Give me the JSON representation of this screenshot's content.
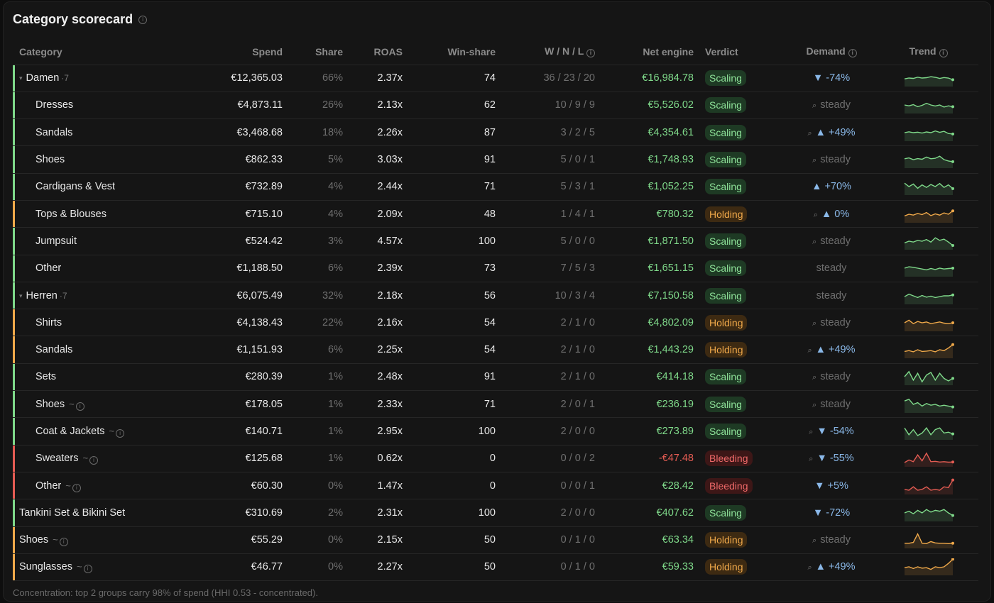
{
  "title": "Category scorecard",
  "columns": {
    "category": "Category",
    "spend": "Spend",
    "share": "Share",
    "roas": "ROAS",
    "winshare": "Win-share",
    "wnl": "W / N / L",
    "net": "Net engine",
    "verdict": "Verdict",
    "demand": "Demand",
    "trend": "Trend"
  },
  "colors": {
    "scaling": "#7fd98a",
    "holding": "#f0a94a",
    "bleeding": "#e45c53"
  },
  "rows": [
    {
      "name": "Damen",
      "level": "group",
      "count": "7",
      "spend": "€12,365.03",
      "share": "66%",
      "roas": "2.37x",
      "winshare": "74",
      "wnl": "36 / 23 / 20",
      "net": "€16,984.78",
      "net_sign": "pos",
      "verdict": "Scaling",
      "tone": "green",
      "demand": "▼ -74%",
      "demand_mag": false,
      "demand_style": "blue",
      "trend": [
        0.55,
        0.5,
        0.52,
        0.45,
        0.5,
        0.48,
        0.42,
        0.46,
        0.52,
        0.47,
        0.5,
        0.6
      ]
    },
    {
      "name": "Dresses",
      "level": "child",
      "spend": "€4,873.11",
      "share": "26%",
      "roas": "2.13x",
      "winshare": "62",
      "wnl": "10 / 9 / 9",
      "net": "€5,526.02",
      "net_sign": "pos",
      "verdict": "Scaling",
      "tone": "green",
      "demand": "steady",
      "demand_mag": true,
      "demand_style": "steady",
      "trend": [
        0.5,
        0.55,
        0.48,
        0.6,
        0.52,
        0.4,
        0.5,
        0.56,
        0.5,
        0.62,
        0.55,
        0.6
      ]
    },
    {
      "name": "Sandals",
      "level": "child",
      "spend": "€3,468.68",
      "share": "18%",
      "roas": "2.26x",
      "winshare": "87",
      "wnl": "3 / 2 / 5",
      "net": "€4,354.61",
      "net_sign": "pos",
      "verdict": "Scaling",
      "tone": "green",
      "demand": "▲ +49%",
      "demand_mag": true,
      "demand_style": "blue",
      "trend": [
        0.5,
        0.45,
        0.5,
        0.47,
        0.52,
        0.46,
        0.5,
        0.4,
        0.48,
        0.42,
        0.55,
        0.58
      ]
    },
    {
      "name": "Shoes",
      "level": "child",
      "spend": "€862.33",
      "share": "5%",
      "roas": "3.03x",
      "winshare": "91",
      "wnl": "5 / 0 / 1",
      "net": "€1,748.93",
      "net_sign": "pos",
      "verdict": "Scaling",
      "tone": "green",
      "demand": "steady",
      "demand_mag": true,
      "demand_style": "steady",
      "trend": [
        0.45,
        0.4,
        0.5,
        0.44,
        0.48,
        0.35,
        0.45,
        0.42,
        0.3,
        0.5,
        0.58,
        0.62
      ]
    },
    {
      "name": "Cardigans & Vest",
      "level": "child",
      "spend": "€732.89",
      "share": "4%",
      "roas": "2.44x",
      "winshare": "71",
      "wnl": "5 / 3 / 1",
      "net": "€1,052.25",
      "net_sign": "pos",
      "verdict": "Scaling",
      "tone": "green",
      "demand": "▲ +70%",
      "demand_mag": false,
      "demand_style": "blue",
      "trend": [
        0.3,
        0.5,
        0.35,
        0.6,
        0.4,
        0.55,
        0.38,
        0.5,
        0.32,
        0.55,
        0.4,
        0.62
      ]
    },
    {
      "name": "Tops & Blouses",
      "level": "child",
      "spend": "€715.10",
      "share": "4%",
      "roas": "2.09x",
      "winshare": "48",
      "wnl": "1 / 4 / 1",
      "net": "€780.32",
      "net_sign": "pos",
      "verdict": "Holding",
      "tone": "amber",
      "demand": "▲ 0%",
      "demand_mag": true,
      "demand_style": "blue",
      "trend": [
        0.6,
        0.5,
        0.55,
        0.45,
        0.52,
        0.4,
        0.58,
        0.48,
        0.55,
        0.42,
        0.5,
        0.3
      ]
    },
    {
      "name": "Jumpsuit",
      "level": "child",
      "spend": "€524.42",
      "share": "3%",
      "roas": "4.57x",
      "winshare": "100",
      "wnl": "5 / 0 / 0",
      "net": "€1,871.50",
      "net_sign": "pos",
      "verdict": "Scaling",
      "tone": "green",
      "demand": "steady",
      "demand_mag": true,
      "demand_style": "steady",
      "trend": [
        0.6,
        0.5,
        0.55,
        0.45,
        0.5,
        0.4,
        0.55,
        0.3,
        0.45,
        0.38,
        0.55,
        0.75
      ]
    },
    {
      "name": "Other",
      "level": "child",
      "spend": "€1,188.50",
      "share": "6%",
      "roas": "2.39x",
      "winshare": "73",
      "wnl": "7 / 5 / 3",
      "net": "€1,651.15",
      "net_sign": "pos",
      "verdict": "Scaling",
      "tone": "green",
      "demand": "steady",
      "demand_mag": false,
      "demand_style": "steady",
      "trend": [
        0.5,
        0.42,
        0.45,
        0.5,
        0.55,
        0.6,
        0.52,
        0.58,
        0.5,
        0.55,
        0.52,
        0.5
      ]
    },
    {
      "name": "Herren",
      "level": "group",
      "count": "7",
      "spend": "€6,075.49",
      "share": "32%",
      "roas": "2.18x",
      "winshare": "56",
      "wnl": "10 / 3 / 4",
      "net": "€7,150.58",
      "net_sign": "pos",
      "verdict": "Scaling",
      "tone": "green",
      "demand": "steady",
      "demand_mag": false,
      "demand_style": "steady",
      "trend": [
        0.55,
        0.4,
        0.5,
        0.6,
        0.48,
        0.58,
        0.52,
        0.6,
        0.55,
        0.5,
        0.5,
        0.45
      ]
    },
    {
      "name": "Shirts",
      "level": "child",
      "spend": "€4,138.43",
      "share": "22%",
      "roas": "2.16x",
      "winshare": "54",
      "wnl": "2 / 1 / 0",
      "net": "€4,802.09",
      "net_sign": "pos",
      "verdict": "Holding",
      "tone": "amber",
      "demand": "steady",
      "demand_mag": true,
      "demand_style": "steady",
      "trend": [
        0.5,
        0.35,
        0.55,
        0.42,
        0.5,
        0.45,
        0.55,
        0.5,
        0.45,
        0.52,
        0.55,
        0.5
      ]
    },
    {
      "name": "Sandals",
      "level": "child",
      "spend": "€1,151.93",
      "share": "6%",
      "roas": "2.25x",
      "winshare": "54",
      "wnl": "2 / 1 / 0",
      "net": "€1,443.29",
      "net_sign": "pos",
      "verdict": "Holding",
      "tone": "amber",
      "demand": "▲ +49%",
      "demand_mag": true,
      "demand_style": "blue",
      "trend": [
        0.6,
        0.55,
        0.62,
        0.5,
        0.6,
        0.58,
        0.55,
        0.62,
        0.5,
        0.55,
        0.4,
        0.2
      ]
    },
    {
      "name": "Sets",
      "level": "child",
      "spend": "€280.39",
      "share": "1%",
      "roas": "2.48x",
      "winshare": "91",
      "wnl": "2 / 1 / 0",
      "net": "€414.18",
      "net_sign": "pos",
      "verdict": "Scaling",
      "tone": "green",
      "demand": "steady",
      "demand_mag": true,
      "demand_style": "steady",
      "trend": [
        0.5,
        0.2,
        0.7,
        0.3,
        0.8,
        0.4,
        0.25,
        0.7,
        0.3,
        0.6,
        0.75,
        0.6
      ]
    },
    {
      "name": "Shoes",
      "level": "child",
      "tilde": true,
      "spend": "€178.05",
      "share": "1%",
      "roas": "2.33x",
      "winshare": "71",
      "wnl": "2 / 0 / 1",
      "net": "€236.19",
      "net_sign": "pos",
      "verdict": "Scaling",
      "tone": "green",
      "demand": "steady",
      "demand_mag": true,
      "demand_style": "steady",
      "trend": [
        0.3,
        0.2,
        0.5,
        0.4,
        0.6,
        0.45,
        0.55,
        0.5,
        0.6,
        0.55,
        0.6,
        0.65
      ]
    },
    {
      "name": "Coat & Jackets",
      "level": "child",
      "tilde": true,
      "spend": "€140.71",
      "share": "1%",
      "roas": "2.95x",
      "winshare": "100",
      "wnl": "2 / 0 / 0",
      "net": "€273.89",
      "net_sign": "pos",
      "verdict": "Scaling",
      "tone": "green",
      "demand": "▼ -54%",
      "demand_mag": true,
      "demand_style": "blue",
      "trend": [
        0.3,
        0.7,
        0.4,
        0.75,
        0.6,
        0.3,
        0.7,
        0.4,
        0.3,
        0.6,
        0.55,
        0.65
      ]
    },
    {
      "name": "Sweaters",
      "level": "child",
      "tilde": true,
      "spend": "€125.68",
      "share": "1%",
      "roas": "0.62x",
      "winshare": "0",
      "wnl": "0 / 0 / 2",
      "net": "-€47.48",
      "net_sign": "neg",
      "verdict": "Bleeding",
      "tone": "red",
      "demand": "▼ -55%",
      "demand_mag": true,
      "demand_style": "blue",
      "trend": [
        0.75,
        0.6,
        0.7,
        0.3,
        0.65,
        0.2,
        0.7,
        0.68,
        0.72,
        0.7,
        0.73,
        0.72
      ]
    },
    {
      "name": "Other",
      "level": "child",
      "tilde": true,
      "spend": "€60.30",
      "share": "0%",
      "roas": "1.47x",
      "winshare": "0",
      "wnl": "0 / 0 / 1",
      "net": "€28.42",
      "net_sign": "pos",
      "verdict": "Bleeding",
      "tone": "red",
      "demand": "▼ +5%",
      "demand_mag": false,
      "demand_style": "blue",
      "trend": [
        0.7,
        0.75,
        0.55,
        0.75,
        0.7,
        0.55,
        0.75,
        0.7,
        0.75,
        0.55,
        0.6,
        0.15
      ]
    },
    {
      "name": "Tankini Set & Bikini Set",
      "level": "top",
      "spend": "€310.69",
      "share": "2%",
      "roas": "2.31x",
      "winshare": "100",
      "wnl": "2 / 0 / 0",
      "net": "€407.62",
      "net_sign": "pos",
      "verdict": "Scaling",
      "tone": "green",
      "demand": "▼ -72%",
      "demand_mag": false,
      "demand_style": "blue",
      "trend": [
        0.5,
        0.4,
        0.55,
        0.35,
        0.5,
        0.3,
        0.45,
        0.35,
        0.4,
        0.3,
        0.5,
        0.65
      ]
    },
    {
      "name": "Shoes",
      "level": "top",
      "tilde": true,
      "spend": "€55.29",
      "share": "0%",
      "roas": "2.15x",
      "winshare": "50",
      "wnl": "0 / 1 / 0",
      "net": "€63.34",
      "net_sign": "pos",
      "verdict": "Holding",
      "tone": "amber",
      "demand": "steady",
      "demand_mag": true,
      "demand_style": "steady",
      "trend": [
        0.7,
        0.7,
        0.65,
        0.15,
        0.7,
        0.72,
        0.6,
        0.68,
        0.7,
        0.7,
        0.72,
        0.7
      ]
    },
    {
      "name": "Sunglasses",
      "level": "top",
      "tilde": true,
      "spend": "€46.77",
      "share": "0%",
      "roas": "2.27x",
      "winshare": "50",
      "wnl": "0 / 1 / 0",
      "net": "€59.33",
      "net_sign": "pos",
      "verdict": "Holding",
      "tone": "amber",
      "demand": "▲ +49%",
      "demand_mag": true,
      "demand_style": "blue",
      "trend": [
        0.55,
        0.5,
        0.6,
        0.5,
        0.58,
        0.55,
        0.65,
        0.5,
        0.55,
        0.5,
        0.3,
        0.05
      ]
    }
  ],
  "footer": "Concentration: top 2 groups carry 98% of spend (HHI 0.53 - concentrated)."
}
